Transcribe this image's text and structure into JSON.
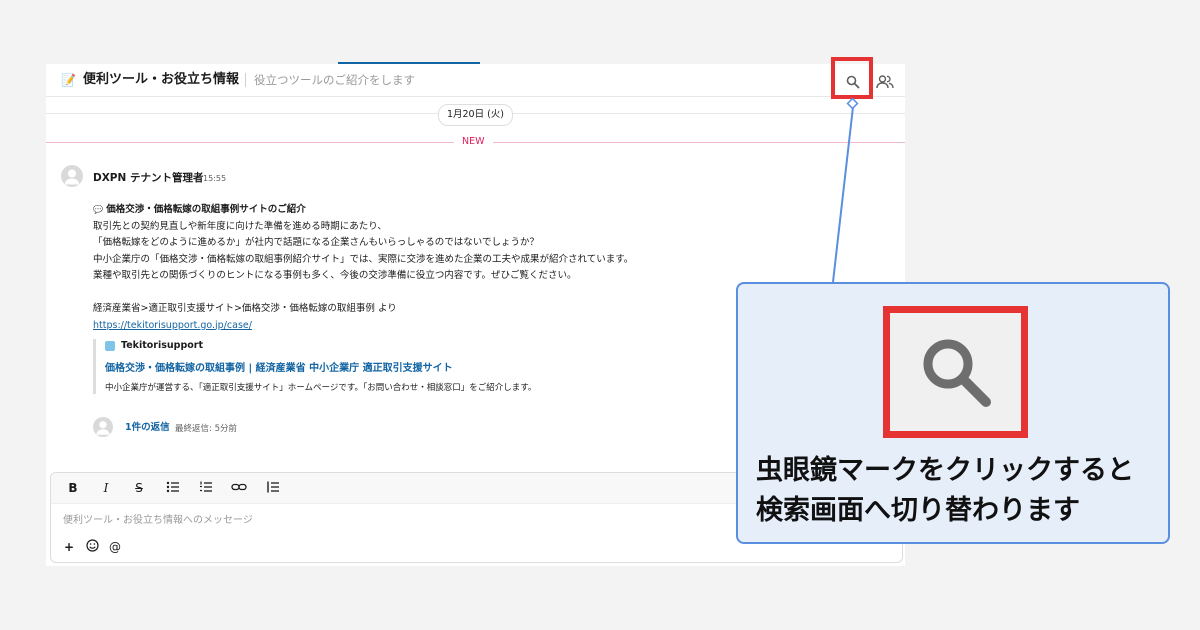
{
  "channel": {
    "emoji": "📝",
    "name": "便利ツール・お役立ち情報",
    "topic": "役立つツールのご紹介をします"
  },
  "header_icons": {
    "search": "search-icon",
    "members": "members-icon"
  },
  "divider": {
    "date": "1月20日 (火)",
    "new_label": "NEW"
  },
  "message": {
    "author": "DXPN テナント管理者",
    "time": "15:55",
    "title_emoji": "💬",
    "title": "価格交渉・価格転嫁の取組事例サイトのご紹介",
    "lines": [
      "取引先との契約見直しや新年度に向けた準備を進める時期にあたり、",
      "「価格転嫁をどのように進めるか」が社内で話題になる企業さんもいらっしゃるのではないでしょうか？",
      "中小企業庁の「価格交渉・価格転嫁の取組事例紹介サイト」では、実際に交渉を進めた企業の工夫や成果が紹介されています。",
      "業種や取引先との関係づくりのヒントになる事例も多く、今後の交渉準備に役立つ内容です。ぜひご覧ください。"
    ],
    "source": "経済産業省>適正取引支援サイト>価格交渉・価格転嫁の取組事例 より",
    "url": "https://tekitorisupport.go.jp/case/",
    "unfurl": {
      "site": "Tekitorisupport",
      "title": "価格交渉・価格転嫁の取組事例 | 経済産業省 中小企業庁 適正取引支援サイト",
      "description": "中小企業庁が運営する、「適正取引支援サイト」ホームページです。「お問い合わせ・相談窓口」をご紹介します。"
    },
    "replies": {
      "count": "1件の返信",
      "last": "最終返信: 5分前"
    }
  },
  "composer": {
    "toolbar": {
      "bold": "B",
      "italic": "I",
      "strike": "S",
      "bullet_list": "bullet-list-icon",
      "numbered_list": "numbered-list-icon",
      "link": "link-icon",
      "block": "blockquote-icon"
    },
    "placeholder": "便利ツール・お役立ち情報へのメッセージ",
    "add": "+",
    "emoji": "emoji-icon",
    "mention": "@"
  },
  "annotation": {
    "text_line1": "虫眼鏡マークをクリックすると",
    "text_line2": "検索画面へ切り替わります",
    "highlight_color": "#e53333",
    "callout_border": "#5a8ee0",
    "callout_bg": "#e6eefa"
  }
}
